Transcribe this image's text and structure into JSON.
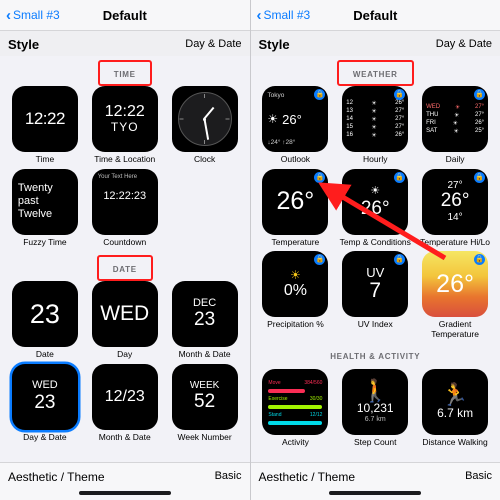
{
  "left": {
    "nav": {
      "back": "Small #3",
      "title": "Default",
      "back_icon": "chevron-left-icon"
    },
    "stylebar": {
      "left": "Style",
      "right": "Day & Date"
    },
    "sections": [
      {
        "header": "TIME",
        "annotated": true,
        "tiles": [
          {
            "name": "time",
            "caption": "Time",
            "value": "12:22",
            "kind": "time"
          },
          {
            "name": "time-location",
            "caption": "Time & Location",
            "value": "12:22",
            "sub": "TYO",
            "kind": "time-loc"
          },
          {
            "name": "clock",
            "caption": "Clock",
            "kind": "analog-clock"
          },
          {
            "name": "fuzzy-time",
            "caption": "Fuzzy Time",
            "value": "Twenty past Twelve",
            "kind": "words"
          },
          {
            "name": "countdown",
            "caption": "Countdown",
            "value": "12:22:23",
            "note": "Your Text Here",
            "kind": "countdown"
          }
        ]
      },
      {
        "header": "DATE",
        "annotated": true,
        "tiles": [
          {
            "name": "date",
            "caption": "Date",
            "value": "23",
            "kind": "num-big"
          },
          {
            "name": "day",
            "caption": "Day",
            "value": "WED",
            "kind": "num-mid"
          },
          {
            "name": "month-and-date",
            "caption": "Month & Date",
            "value": "23",
            "sub": "DEC",
            "kind": "stack"
          },
          {
            "name": "day-and-date",
            "caption": "Day & Date",
            "value": "23",
            "sub": "WED",
            "kind": "stack",
            "selected": true
          },
          {
            "name": "month-date-numeric",
            "caption": "Month & Date",
            "value": "12/23",
            "kind": "num-sm"
          },
          {
            "name": "week-number",
            "caption": "Week Number",
            "value": "52",
            "sub": "WEEK",
            "kind": "stack"
          }
        ]
      }
    ],
    "bottom": {
      "left": "Aesthetic / Theme",
      "right": "Basic"
    }
  },
  "right": {
    "nav": {
      "back": "Small #3",
      "title": "Default",
      "back_icon": "chevron-left-icon"
    },
    "stylebar": {
      "left": "Style",
      "right": "Day & Date"
    },
    "sections": [
      {
        "header": "WEATHER",
        "annotated": true,
        "tiles": [
          {
            "name": "outlook",
            "caption": "Outlook",
            "value": "26°",
            "city": "Tokyo",
            "footer": "↓24° ↑28°",
            "kind": "outlook",
            "locked": true
          },
          {
            "name": "hourly",
            "caption": "Hourly",
            "kind": "hourly",
            "locked": true,
            "rows": [
              [
                "12",
                "☀",
                "26°"
              ],
              [
                "13",
                "☀",
                "27°"
              ],
              [
                "14",
                "☀",
                "27°"
              ],
              [
                "15",
                "☀",
                "27°"
              ],
              [
                "16",
                "☀",
                "26°"
              ]
            ]
          },
          {
            "name": "daily",
            "caption": "Daily",
            "kind": "daily",
            "locked": true,
            "head": "WED THU FRI SAT",
            "rows": [
              [
                "WED",
                "☀",
                "27°"
              ],
              [
                "THU",
                "☀",
                "27°"
              ],
              [
                "FRI",
                "☀",
                "26°"
              ],
              [
                "SAT",
                "☀",
                "25°"
              ]
            ]
          },
          {
            "name": "temperature",
            "caption": "Temperature",
            "value": "26°",
            "kind": "deg-big",
            "locked": true
          },
          {
            "name": "temp-and-conditions",
            "caption": "Temp & Conditions",
            "value": "26°",
            "kind": "deg-cond",
            "locked": true
          },
          {
            "name": "temperature-hi-lo",
            "caption": "Temperature Hi/Lo",
            "value": "26°",
            "hi": "27°",
            "lo": "14°",
            "kind": "hi-lo",
            "locked": true
          },
          {
            "name": "precipitation-percent",
            "caption": "Precipitation %",
            "value": "0%",
            "kind": "precip",
            "locked": true
          },
          {
            "name": "uv-index",
            "caption": "UV Index",
            "value": "7",
            "sub": "UV",
            "kind": "uv",
            "locked": true
          },
          {
            "name": "gradient-temperature",
            "caption": "Gradient Temperature",
            "value": "26°",
            "kind": "gradient",
            "locked": true
          }
        ]
      },
      {
        "header": "HEALTH & ACTIVITY",
        "annotated": false,
        "tiles": [
          {
            "name": "activity",
            "caption": "Activity",
            "kind": "activity",
            "rows": [
              [
                "Move",
                "384/560"
              ],
              [
                "Exercise",
                "30/30"
              ],
              [
                "Stand",
                "12/12"
              ]
            ]
          },
          {
            "name": "step-count",
            "caption": "Step Count",
            "value": "10,231",
            "sub": "6.7 km",
            "kind": "steps"
          },
          {
            "name": "distance-walking",
            "caption": "Distance Walking",
            "value": "6.7 km",
            "kind": "distance"
          }
        ]
      }
    ],
    "bottom": {
      "left": "Aesthetic / Theme",
      "right": "Basic"
    },
    "annotation": {
      "arrow": "red-arrow-pointing-to-temp-and-conditions"
    }
  }
}
